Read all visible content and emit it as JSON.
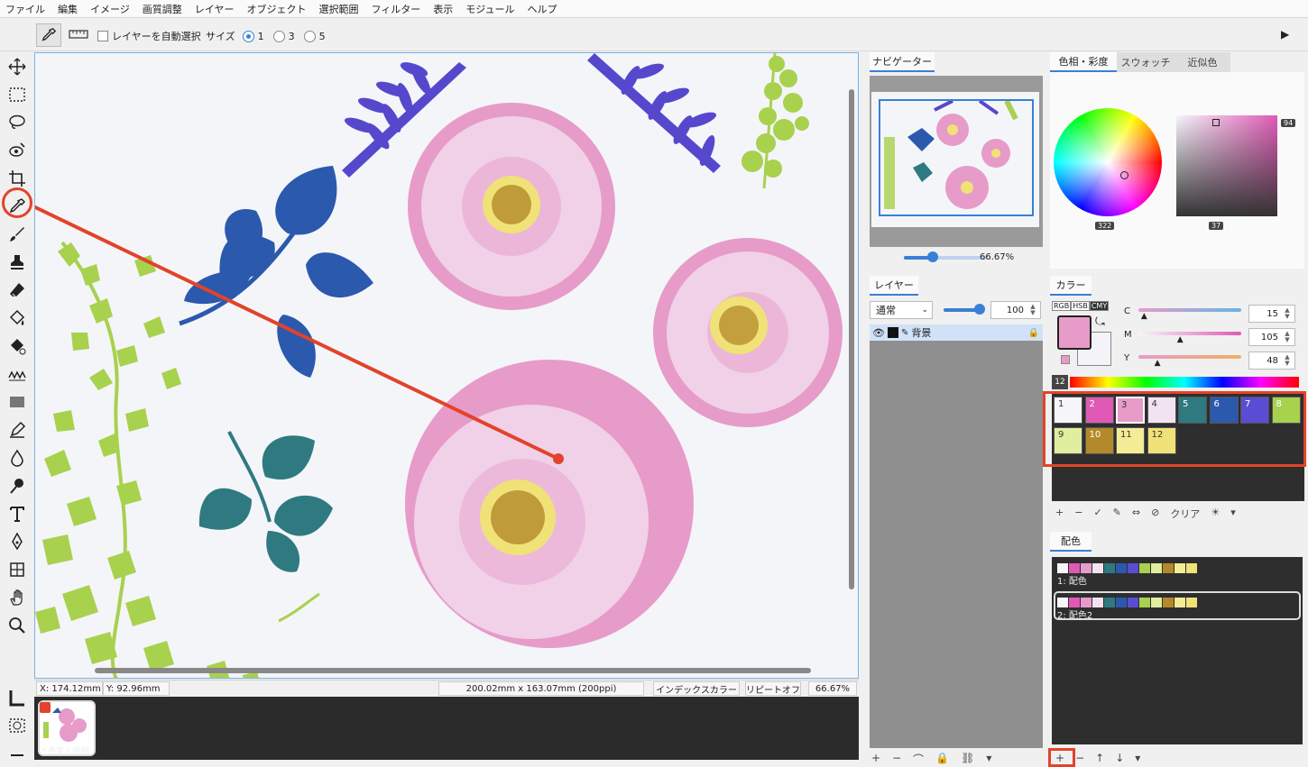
{
  "menu": [
    "ファイル",
    "編集",
    "イメージ",
    "画質調整",
    "レイヤー",
    "オブジェクト",
    "選択範囲",
    "フィルター",
    "表示",
    "モジュール",
    "ヘルプ"
  ],
  "options": {
    "auto_select_label": "レイヤーを自動選択",
    "size_label": "サイズ",
    "size_options": [
      "1",
      "3",
      "5"
    ],
    "size_selected": "1"
  },
  "tools": [
    "move-tool",
    "rect-select-tool",
    "lasso-tool",
    "magic-select-tool",
    "crop-tool",
    "eyedropper-tool",
    "brush-tool",
    "stamp-tool",
    "eraser-tool",
    "fill-tool",
    "gradient-fill-tool",
    "wave-tool",
    "shape-tool",
    "pen-edit-tool",
    "drop-tool",
    "dodge-tool",
    "text-tool",
    "pen-tool",
    "transform-tool",
    "hand-tool",
    "zoom-tool"
  ],
  "status": {
    "x": "X: 174.12mm",
    "y": "Y:  92.96mm",
    "dimensions": "200.02mm x 163.07mm (200ppi)",
    "mode": "インデックスカラー",
    "repeat": "リピートオフ",
    "zoom": "66.67%"
  },
  "filmstrip": {
    "doc_label": "* 色変え説明"
  },
  "navigator": {
    "tab": "ナビゲーター",
    "zoom": "66.67%",
    "zoom_fraction": 0.35
  },
  "layers": {
    "tab": "レイヤー",
    "blend_mode": "通常",
    "opacity": "100",
    "opacity_fraction": 1.0,
    "items": [
      {
        "name": "背景"
      }
    ]
  },
  "hue_panel": {
    "tabs": [
      "色相・彩度",
      "スウォッチ",
      "近似色"
    ],
    "hue_value": "322",
    "sat_value": "37",
    "bright_value": "94"
  },
  "color_panel": {
    "tab": "カラー",
    "modes": [
      "RGB",
      "HSB",
      "CMY"
    ],
    "active_mode": "CMY",
    "channels": [
      {
        "label": "C",
        "value": "15",
        "fraction": 0.06
      },
      {
        "label": "M",
        "value": "105",
        "fraction": 0.41
      },
      {
        "label": "Y",
        "value": "48",
        "fraction": 0.19
      }
    ],
    "fg_color": "#e79bc9",
    "bg_color": "#f4f4f8",
    "palette_count": "12",
    "palette": [
      {
        "n": "1",
        "color": "#f6f6fa"
      },
      {
        "n": "2",
        "color": "#e05ab5"
      },
      {
        "n": "3",
        "color": "#e79bc9"
      },
      {
        "n": "4",
        "color": "#f3e3f2"
      },
      {
        "n": "5",
        "color": "#2e7a80"
      },
      {
        "n": "6",
        "color": "#2b59ad"
      },
      {
        "n": "7",
        "color": "#5a4dd3"
      },
      {
        "n": "8",
        "color": "#a8d14e"
      },
      {
        "n": "9",
        "color": "#e0ef9e"
      },
      {
        "n": "10",
        "color": "#b4892b"
      },
      {
        "n": "11",
        "color": "#f4ec96"
      },
      {
        "n": "12",
        "color": "#f0e276"
      }
    ],
    "actions": [
      "+",
      "−",
      "✓",
      "✎",
      "⇔",
      "⊘",
      "クリア",
      "☀",
      "▾"
    ]
  },
  "scheme_panel": {
    "tab": "配色",
    "schemes": [
      {
        "label": "1: 配色"
      },
      {
        "label": "2: 配色2"
      }
    ],
    "actions": [
      "+",
      "−",
      "↑",
      "↓",
      "▾"
    ]
  },
  "layer_actions": [
    "+",
    "−",
    "⌒",
    "🔒",
    "⛓",
    "▾"
  ]
}
